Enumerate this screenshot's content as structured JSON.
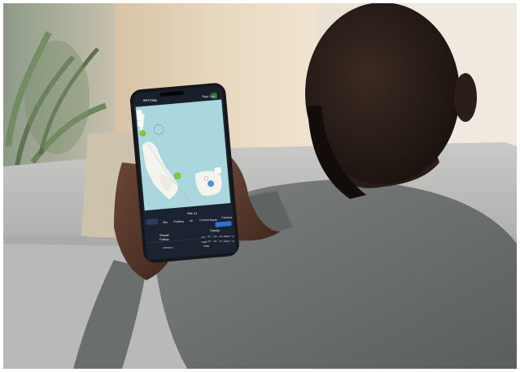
{
  "app": {
    "brand": "SPYTEK",
    "signout_label": "Sign Out",
    "site_label": "Site #1",
    "tabs": [
      "Site",
      "Outlines",
      "All",
      "Current Mode",
      "Camera"
    ],
    "visibility_label": "Opacity",
    "field_label": "Sheriff Follow",
    "lat_label": "LAT",
    "lat_value": "47° 33' 33.9502\" N",
    "long_label": "LONG",
    "long_value": "58° 36' 57.0682\" W",
    "bottom_left": "ARTEMIS",
    "bottom_right": "ZONE"
  },
  "colors": {
    "map_water": "#aad6dd",
    "map_land": "#f4f4ef",
    "marker_green": "#7acb3a",
    "ui_dark": "#1b2230",
    "accent_blue": "#2f6fd6"
  }
}
